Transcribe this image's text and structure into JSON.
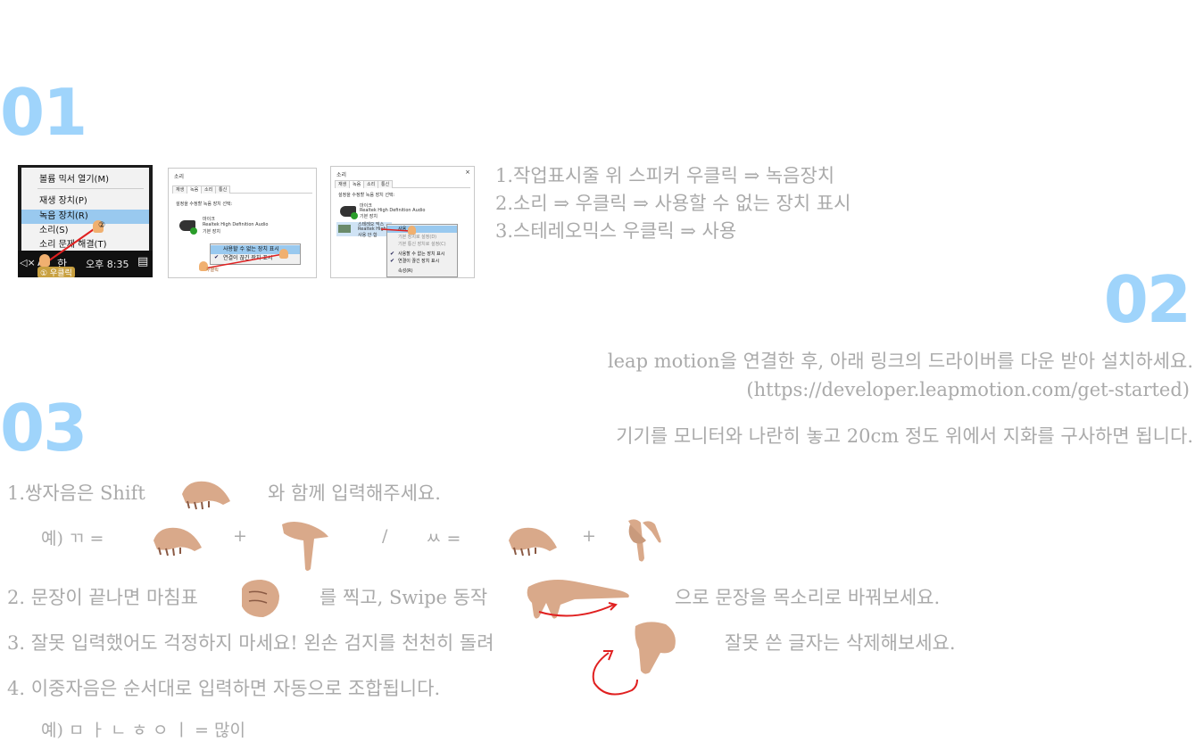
{
  "section1": {
    "number": "01",
    "steps": [
      "1.작업표시줄 위 스피커 우클릭 ⇒ 녹음장치",
      "2.소리 ⇒ 우클릭 ⇒ 사용할 수 없는 장치 표시",
      "3.스테레오믹스 우클릭 ⇒ 사용"
    ],
    "screenshot1": {
      "menu_items": [
        "볼륨 믹서 열기(M)",
        "재생 장치(P)",
        "녹음 장치(R)",
        "소리(S)",
        "소리 문제 해결(T)"
      ],
      "taskbar_ime": "A",
      "taskbar_han": "한",
      "taskbar_time": "오후 8:35",
      "step_badge_1": "① 우클릭",
      "step_badge_2": "②"
    },
    "screenshot2": {
      "title": "소리",
      "tabs": [
        "재생",
        "녹음",
        "소리",
        "통신"
      ],
      "instruction": "설정을 수정할 녹음 장치 선택:",
      "device_name": "마이크",
      "device_sub": "Realtek High Definition Audio",
      "device_status": "기본 장치",
      "context_items": [
        "사용할 수 없는 장치 표시",
        "연결이 끊긴 장치 표시"
      ],
      "click_badge": "우클릭"
    },
    "screenshot3": {
      "title": "소리",
      "tabs": [
        "재생",
        "녹음",
        "소리",
        "통신"
      ],
      "instruction": "설정을 수정할 녹음 장치 선택:",
      "device1_name": "마이크",
      "device1_sub": "Realtek High Definition Audio",
      "device1_status": "기본 장치",
      "device2_name": "스테레오 믹스",
      "device2_sub": "Realtek High",
      "device2_status": "사용 안 함",
      "context_items": [
        "사용",
        "기본 장치로 설정(D)",
        "기본 통신 장치로 설정(C)",
        "사용할 수 없는 장치 표시",
        "연결이 끊긴 장치 표시",
        "속성(R)"
      ]
    }
  },
  "section2": {
    "number": "02",
    "line1": "leap motion을 연결한 후, 아래 링크의 드라이버를 다운 받아 설치하세요.",
    "line2": "(https://developer.leapmotion.com/get-started)",
    "line3": "기기를 모니터와 나란히 놓고 20cm 정도 위에서 지화를 구사하면 됩니다."
  },
  "section3": {
    "number": "03",
    "rule1_a": "1.쌍자음은 Shift",
    "rule1_b": "와 함께 입력해주세요.",
    "example1_prefix": "예) ㄲ =",
    "plus": "+",
    "slash": "/",
    "example1_b": "ㅆ =",
    "rule2_a": "2. 문장이 끝나면 마침표",
    "rule2_b": "를 찍고, Swipe 동작",
    "rule2_c": "으로 문장을 목소리로 바꿔보세요.",
    "rule3_a": "3. 잘못 입력했어도 걱정하지 마세요! 왼손 검지를 천천히 돌려",
    "rule3_b": "잘못 쓴 글자는 삭제해보세요.",
    "rule4": "4. 이중자음은 순서대로 입력하면 자동으로 조합됩니다.",
    "example4": "예) ㅁ ㅏ ㄴ ㅎ ㅇ ㅣ = 많이"
  },
  "colors": {
    "number": "#9fd4fb",
    "text": "#aaaaaa",
    "arrow": "#e02020",
    "skin": "#d9a98a"
  }
}
